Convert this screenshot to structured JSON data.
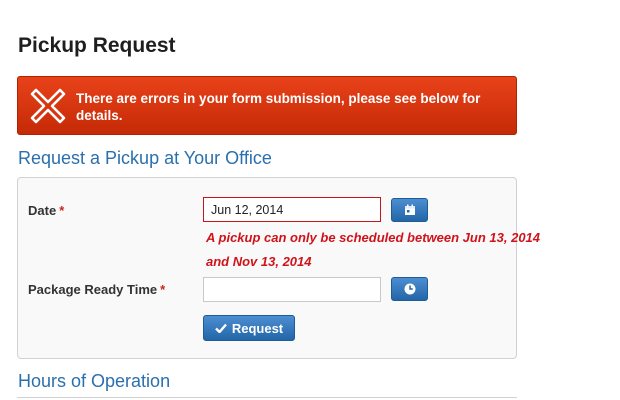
{
  "page": {
    "title": "Pickup Request"
  },
  "error_banner": {
    "message": "There are errors in your form submission, please see below for details.",
    "icon": "error-x-icon",
    "color": "#d9360f"
  },
  "section": {
    "title": "Request a Pickup at Your Office",
    "date": {
      "label": "Date",
      "required_mark": "*",
      "value": "Jun 12, 2014",
      "error": "A pickup can only be scheduled between Jun 13, 2014 and Nov 13, 2014"
    },
    "ready_time": {
      "label": "Package Ready Time",
      "required_mark": "*",
      "value": ""
    },
    "submit_label": "Request"
  },
  "hours_section": {
    "title": "Hours of Operation"
  },
  "colors": {
    "accent": "#2a6fae",
    "error": "#d0131a",
    "button": "#2f74b8"
  }
}
